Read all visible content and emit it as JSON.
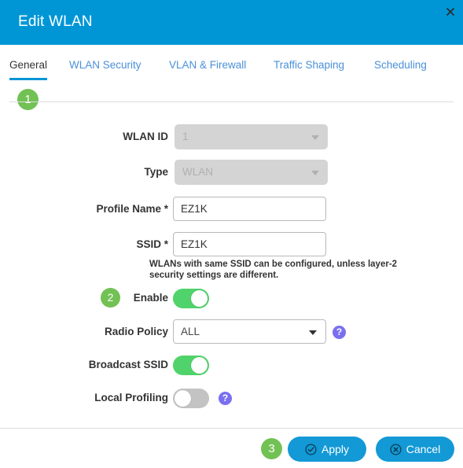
{
  "window": {
    "title": "Edit WLAN",
    "close_icon": "close-icon",
    "header_color": "#0096d6"
  },
  "tabs": [
    {
      "label": "General",
      "active": true
    },
    {
      "label": "WLAN Security",
      "active": false
    },
    {
      "label": "VLAN & Firewall",
      "active": false
    },
    {
      "label": "Traffic Shaping",
      "active": false
    },
    {
      "label": "Scheduling",
      "active": false
    }
  ],
  "callouts": [
    {
      "number": "1"
    },
    {
      "number": "2"
    },
    {
      "number": "3"
    }
  ],
  "form": {
    "wlan_id": {
      "label": "WLAN ID",
      "value": "1",
      "disabled": true,
      "control": "dropdown"
    },
    "type": {
      "label": "Type",
      "value": "WLAN",
      "disabled": true,
      "control": "dropdown"
    },
    "profile_name": {
      "label": "Profile Name *",
      "value": "EZ1K",
      "control": "text"
    },
    "ssid": {
      "label": "SSID *",
      "value": "EZ1K",
      "control": "text",
      "help": "WLANs with same SSID can be configured, unless layer-2 security settings are different."
    },
    "enable": {
      "label": "Enable",
      "state": "on",
      "control": "toggle"
    },
    "radio_policy": {
      "label": "Radio Policy",
      "value": "ALL",
      "control": "dropdown",
      "help_icon": "help-icon"
    },
    "broadcast_ssid": {
      "label": "Broadcast SSID",
      "state": "on",
      "control": "toggle"
    },
    "local_profiling": {
      "label": "Local Profiling",
      "state": "off",
      "control": "toggle",
      "help_icon": "help-icon"
    }
  },
  "footer": {
    "apply_label": "Apply",
    "cancel_label": "Cancel",
    "apply_icon": "check-circle-icon",
    "cancel_icon": "x-circle-icon",
    "button_color": "#1299d6"
  },
  "colors": {
    "header_blue": "#0096d6",
    "tab_blue": "#4a90d9",
    "badge_green": "#72c154",
    "toggle_green": "#4fd36a",
    "toggle_gray": "#c3c3c3",
    "help_purple": "#7b6ff0",
    "button_blue": "#1299d6",
    "disabled_gray": "#d4d4d4"
  }
}
